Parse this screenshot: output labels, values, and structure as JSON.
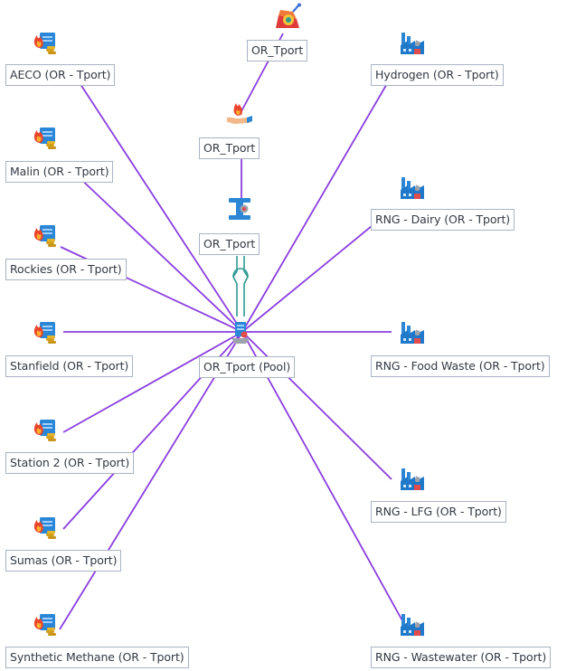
{
  "colors": {
    "edge": "#8a3ee0",
    "pipe": "#2e9a92",
    "label_border": "#a9b4c2",
    "label_text": "#333a44"
  },
  "nodes": {
    "aeco": {
      "label": "AECO (OR - Tport)",
      "icon": "gas-supply-icon"
    },
    "malin": {
      "label": "Malin (OR - Tport)",
      "icon": "gas-supply-icon"
    },
    "rockies": {
      "label": "Rockies (OR - Tport)",
      "icon": "gas-supply-icon"
    },
    "stanfield": {
      "label": "Stanfield (OR - Tport)",
      "icon": "gas-supply-icon"
    },
    "station2": {
      "label": "Station 2 (OR - Tport)",
      "icon": "gas-supply-icon"
    },
    "sumas": {
      "label": "Sumas (OR - Tport)",
      "icon": "gas-supply-icon"
    },
    "synthetic": {
      "label": "Synthetic Methane (OR - Tport)",
      "icon": "gas-supply-icon"
    },
    "or_tport_top": {
      "label": "OR_Tport",
      "icon": "gas-burner-icon"
    },
    "or_tport_hand": {
      "label": "OR_Tport",
      "icon": "flame-hand-icon"
    },
    "or_tport_pipe": {
      "label": "OR_Tport",
      "icon": "pipeline-valve-icon"
    },
    "pool": {
      "label": "OR_Tport (Pool)",
      "icon": "pool-hub-icon"
    },
    "hydrogen": {
      "label": "Hydrogen (OR - Tport)",
      "icon": "factory-icon"
    },
    "rng_dairy": {
      "label": "RNG - Dairy (OR - Tport)",
      "icon": "factory-icon"
    },
    "rng_food": {
      "label": "RNG - Food Waste (OR - Tport)",
      "icon": "factory-icon"
    },
    "rng_lfg": {
      "label": "RNG - LFG (OR - Tport)",
      "icon": "factory-icon"
    },
    "rng_ww": {
      "label": "RNG - Wastewater (OR - Tport)",
      "icon": "factory-icon"
    }
  }
}
